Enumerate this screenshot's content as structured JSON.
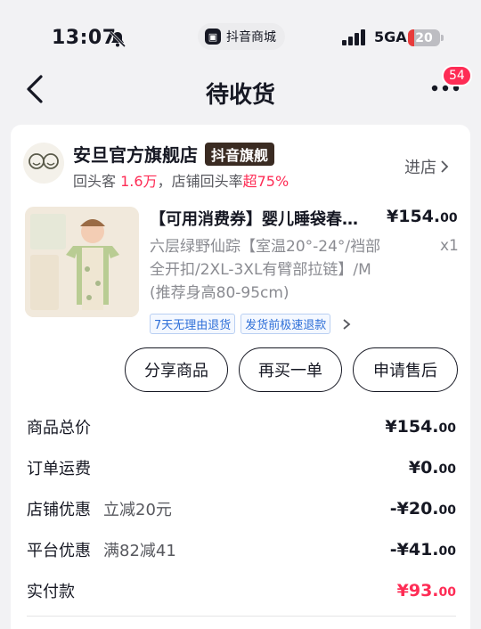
{
  "status_bar": {
    "time": "13:07",
    "mini_app_label": "抖音商城",
    "network": "5GA",
    "battery": "20",
    "battery_level": 0.2,
    "icons": [
      "bell-off-icon",
      "signal-icon",
      "battery-icon"
    ]
  },
  "nav": {
    "title": "待收货",
    "badge_count": "54",
    "icons": [
      "back-arrow-icon",
      "more-icon"
    ]
  },
  "shop": {
    "name": "安旦官方旗舰店",
    "tag": "抖音旗舰",
    "repeat_prefix": "回头客",
    "repeat_count": "1.6万",
    "repeat_rate_prefix": "，店铺回头率",
    "repeat_rate": "超75%",
    "enter_label": "进店"
  },
  "product": {
    "title": "【可用消费券】婴儿睡袋春…",
    "price_int": "¥154.",
    "price_dec": "00",
    "spec": "六层绿野仙踪【室温20°-24°/裆部全开扣/2XL-3XL有臂部拉链】/M (推荐身高80-95cm)",
    "qty": "x1",
    "tags": [
      "7天无理由退货",
      "发货前极速退款"
    ]
  },
  "actions": {
    "share": "分享商品",
    "rebuy": "再买一单",
    "after_sale": "申请售后"
  },
  "summary": [
    {
      "label": "商品总价",
      "sub": "",
      "int": "¥154.",
      "dec": "00",
      "red": false
    },
    {
      "label": "订单运费",
      "sub": "",
      "int": "¥0.",
      "dec": "00",
      "red": false
    },
    {
      "label": "店铺优惠",
      "sub": "立减20元",
      "int": "-¥20.",
      "dec": "00",
      "red": false
    },
    {
      "label": "平台优惠",
      "sub": "满82减41",
      "int": "-¥41.",
      "dec": "00",
      "red": false
    },
    {
      "label": "实付款",
      "sub": "",
      "int": "¥93.",
      "dec": "00",
      "red": true
    }
  ],
  "colors": {
    "accent_red": "#fe2c55",
    "tag_blue": "#2e6fd8",
    "text": "#161823",
    "muted": "#8a8b91"
  }
}
